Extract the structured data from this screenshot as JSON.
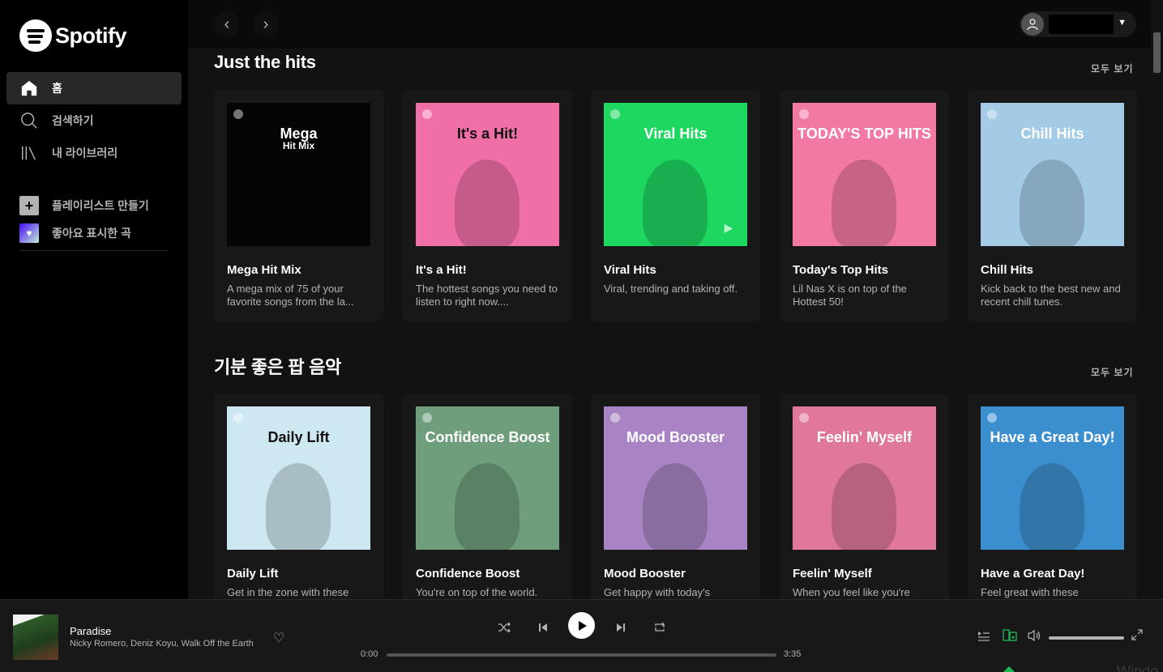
{
  "app": {
    "logo_text": "Spotify"
  },
  "sidebar": {
    "nav": [
      {
        "label": "홈",
        "icon": "home-icon"
      },
      {
        "label": "검색하기",
        "icon": "search-icon"
      },
      {
        "label": "내 라이브러리",
        "icon": "library-icon"
      }
    ],
    "create_playlist": "플레이리스트 만들기",
    "liked_songs": "좋아요 표시한 곡"
  },
  "topbar": {
    "back_icon": "‹",
    "forward_icon": "›",
    "caret": "▼"
  },
  "sections": [
    {
      "title": "Just the hits",
      "see_all": "모두 보기",
      "cards": [
        {
          "art_title": "Mega",
          "art_subtitle": "Hit Mix",
          "title": "Mega Hit Mix",
          "desc": "A mega mix of 75 of your favorite songs from the la...",
          "bg": "#050505",
          "text_color": "#ffffff"
        },
        {
          "art_title": "It's a Hit!",
          "title": "It's a Hit!",
          "desc": "The hottest songs you need to listen to right now....",
          "bg": "#f06fa6",
          "text_color": "#111111"
        },
        {
          "art_title": "Viral Hits",
          "title": "Viral Hits",
          "desc": "Viral, trending and taking off.",
          "bg": "#1ed760",
          "text_color": "#ffffff"
        },
        {
          "art_title": "TODAY'S TOP HITS",
          "title": "Today's Top Hits",
          "desc": "Lil Nas X is on top of the Hottest 50!",
          "bg": "#f279a4",
          "text_color": "#ffffff"
        },
        {
          "art_title": "Chill Hits",
          "title": "Chill Hits",
          "desc": "Kick back to the best new and recent chill tunes.",
          "bg": "#a3cbe6",
          "text_color": "#ffffff"
        }
      ]
    },
    {
      "title": "기분 좋은 팝 음악",
      "see_all": "모두 보기",
      "cards": [
        {
          "art_title": "Daily Lift",
          "title": "Daily Lift",
          "desc": "Get in the zone with these",
          "bg": "#cde8f0",
          "text_color": "#111111"
        },
        {
          "art_title": "Confidence Boost",
          "title": "Confidence Boost",
          "desc": "You're on top of the world.",
          "bg": "#6f9e7c",
          "text_color": "#ffffff"
        },
        {
          "art_title": "Mood Booster",
          "title": "Mood Booster",
          "desc": "Get happy with today's",
          "bg": "#a884c4",
          "text_color": "#ffffff"
        },
        {
          "art_title": "Feelin' Myself",
          "title": "Feelin' Myself",
          "desc": "When you feel like you're",
          "bg": "#e0789a",
          "text_color": "#ffffff"
        },
        {
          "art_title": "Have a Great Day!",
          "title": "Have a Great Day!",
          "desc": "Feel great with these",
          "bg": "#3c8fcf",
          "text_color": "#ffffff"
        }
      ]
    }
  ],
  "player": {
    "track_title": "Paradise",
    "track_artists": "Nicky Romero, Deniz Koyu, Walk Off the Earth",
    "time_elapsed": "0:00",
    "time_total": "3:35",
    "progress": 0.0,
    "volume": 1.0,
    "watermark": "Windo"
  },
  "colors": {
    "accent": "#1db954",
    "bg": "#121212",
    "sidebar": "#000000",
    "card": "#181818"
  }
}
